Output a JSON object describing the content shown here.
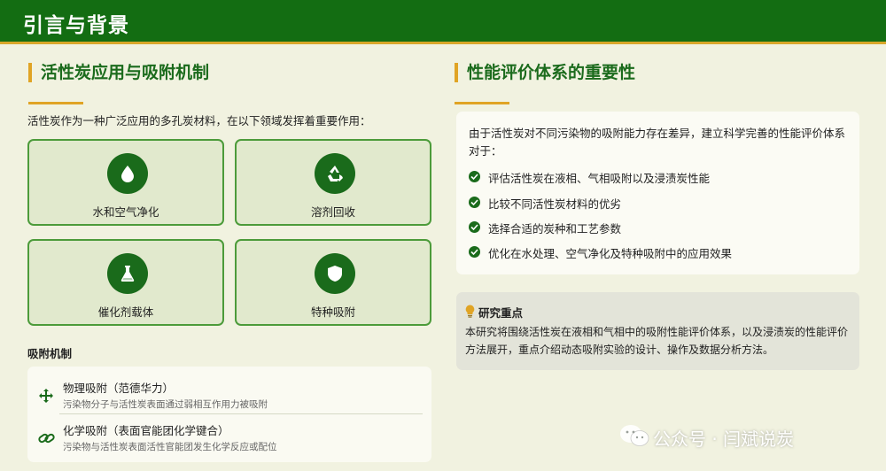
{
  "header": {
    "title": "引言与背景"
  },
  "left": {
    "title": "活性炭应用与吸附机制",
    "intro": "活性炭作为一种广泛应用的多孔炭材料，在以下领域发挥着重要作用：",
    "cards": [
      {
        "label": "水和空气净化",
        "icon": "water-drop-icon"
      },
      {
        "label": "溶剂回收",
        "icon": "recycle-icon"
      },
      {
        "label": "催化剂载体",
        "icon": "flask-icon"
      },
      {
        "label": "特种吸附",
        "icon": "shield-icon"
      }
    ],
    "mechanism": {
      "title": "吸附机制",
      "items": [
        {
          "name": "物理吸附（范德华力）",
          "desc": "污染物分子与活性炭表面通过弱相互作用力被吸附",
          "icon": "arrows-move-icon"
        },
        {
          "name": "化学吸附（表面官能团化学键合）",
          "desc": "污染物与活性炭表面活性官能团发生化学反应或配位",
          "icon": "link-icon"
        }
      ]
    }
  },
  "right": {
    "title": "性能评价体系的重要性",
    "intro": "由于活性炭对不同污染物的吸附能力存在差异，建立科学完善的性能评价体系对于：",
    "checks": [
      "评估活性炭在液相、气相吸附以及浸渍炭性能",
      "比较不同活性炭材料的优劣",
      "选择合适的炭种和工艺参数",
      "优化在水处理、空气净化及特种吸附中的应用效果"
    ],
    "focus": {
      "title": "研究重点",
      "body": "本研究将围绕活性炭在液相和气相中的吸附性能评价体系，以及浸渍炭的性能评价方法展开，重点介绍动态吸附实验的设计、操作及数据分析方法。",
      "icon": "lightbulb-icon"
    }
  },
  "watermark": {
    "text": "公众号 · 闫斌说炭",
    "icon": "wechat-icon"
  },
  "colors": {
    "header": "#136d12",
    "accent": "#e0a425",
    "green": "#1a6b1b",
    "card_bg": "#e1e9cd",
    "card_border": "#4c9b3a"
  }
}
